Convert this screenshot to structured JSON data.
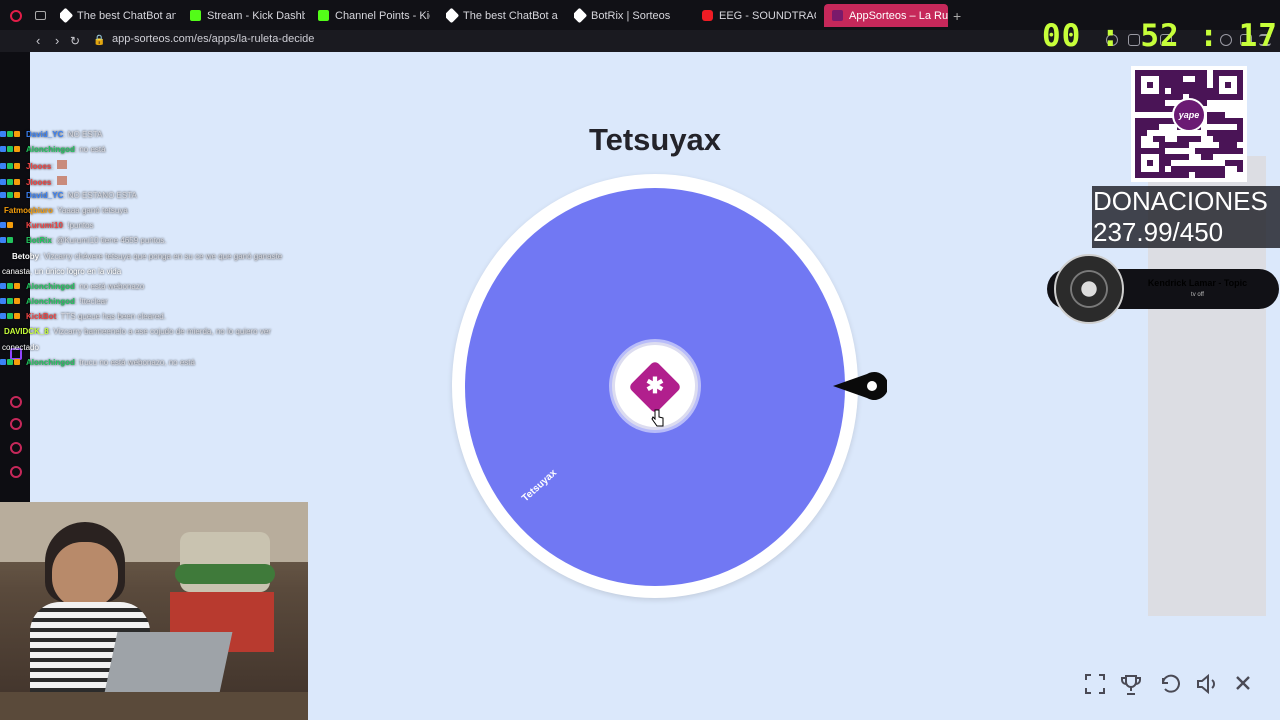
{
  "browser": {
    "tabs": [
      {
        "label": "",
        "icon": "opera-icon"
      },
      {
        "label": "",
        "icon": "workspace-icon"
      },
      {
        "label": "The best ChatBot and",
        "icon": "botrix-icon"
      },
      {
        "label": "Stream - Kick Dashboard",
        "icon": "kick-icon"
      },
      {
        "label": "Channel Points - Kick Da",
        "icon": "kick-icon"
      },
      {
        "label": "The best ChatBot and W",
        "icon": "botrix-icon"
      },
      {
        "label": "BotRix | Sorteos",
        "icon": "botrix-icon"
      },
      {
        "label": "EEG - SOUNDTRACKS ÉP",
        "icon": "youtube-icon"
      },
      {
        "label": "AppSorteos – La Ruleta de",
        "icon": "appsorteos-icon",
        "active": true
      }
    ],
    "new_tab": "+",
    "url": "app-sorteos.com/es/apps/la-ruleta-decide"
  },
  "roulette": {
    "title": "Tetsuyax",
    "segments": [
      {
        "label": "Tetsuyax",
        "color": "#7178f3"
      }
    ],
    "hub_color": "#b11f8d"
  },
  "chat": [
    {
      "user": "David_YC",
      "color": "#3b82f6",
      "msg": ": NO ESTA"
    },
    {
      "user": "Alonchingod",
      "color": "#22c55e",
      "msg": ": no está"
    },
    {
      "user": "Jlooes",
      "color": "#ef4444",
      "msg": ":"
    },
    {
      "user": "Jlooes",
      "color": "#ef4444",
      "msg": ":"
    },
    {
      "user": "David_YC",
      "color": "#3b82f6",
      "msg": ": NO ESTANO ESTA"
    },
    {
      "user": "Fatmoqbiuro",
      "color": "#f59e0b",
      "msg": ": Yaaaa ganó tetsuya"
    },
    {
      "user": "Kurumi10",
      "color": "#ef4444",
      "msg": ": !puntos"
    },
    {
      "user": "BotRix",
      "color": "#22c55e",
      "msg": ": @Kurumi10 tiene 4659 puntos."
    },
    {
      "user": "Betoby",
      "color": "#ffffff",
      "msg": ": Vizcarry chévere tetsuya que ponga en su ce we que ganó ganaste"
    },
    {
      "user": "",
      "color": "#ffffff",
      "msg": "canasta, un único logro en la vida"
    },
    {
      "user": "Alonchingod",
      "color": "#22c55e",
      "msg": ": no está webonazo"
    },
    {
      "user": "Alonchingod",
      "color": "#22c55e",
      "msg": ": !tteclear"
    },
    {
      "user": "KickBot",
      "color": "#ef4444",
      "msg": ": TTS queue has been cleared."
    },
    {
      "user": "DAVIDCK_8",
      "color": "#c7ff3a",
      "msg": ": Vizcarry banneenelo a ese cojudo de mierda, no lo quiero ver"
    },
    {
      "user": "",
      "color": "#ffffff",
      "msg": "conectado"
    },
    {
      "user": "Alonchingod",
      "color": "#22c55e",
      "msg": ": trucu no está webonazo, no está"
    }
  ],
  "timer": "00 : 52 : 17",
  "qr": {
    "badge": "yape"
  },
  "donations": {
    "label": "DONACIONES",
    "value": "237.99/450"
  },
  "music": {
    "title": "Kendrick Lamar - Topic",
    "subtitle": "tv off"
  },
  "controls": {
    "fullscreen": "fullscreen-icon",
    "trophy": "trophy-icon",
    "reset": "undo-icon",
    "sound": "volume-icon",
    "close": "close-icon"
  }
}
